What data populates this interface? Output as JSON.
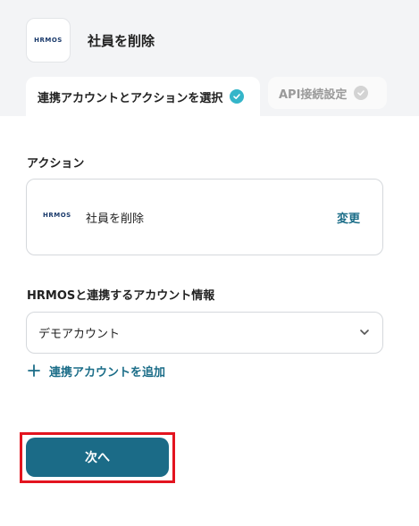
{
  "header": {
    "app_logo": "HRMOS",
    "title": "社員を削除"
  },
  "tabs": [
    {
      "label": "連携アカウントとアクションを選択",
      "active": true
    },
    {
      "label": "API接続設定",
      "active": false
    }
  ],
  "action_section": {
    "label": "アクション",
    "card_logo": "HRMOS",
    "card_text": "社員を削除",
    "change_label": "変更"
  },
  "account_section": {
    "label": "HRMOSと連携するアカウント情報",
    "selected_value": "デモアカウント",
    "add_label": "連携アカウントを追加"
  },
  "footer": {
    "next_label": "次へ"
  },
  "colors": {
    "accent": "#1b6d88",
    "check_active": "#34b5c9",
    "highlight": "#e3141f"
  }
}
